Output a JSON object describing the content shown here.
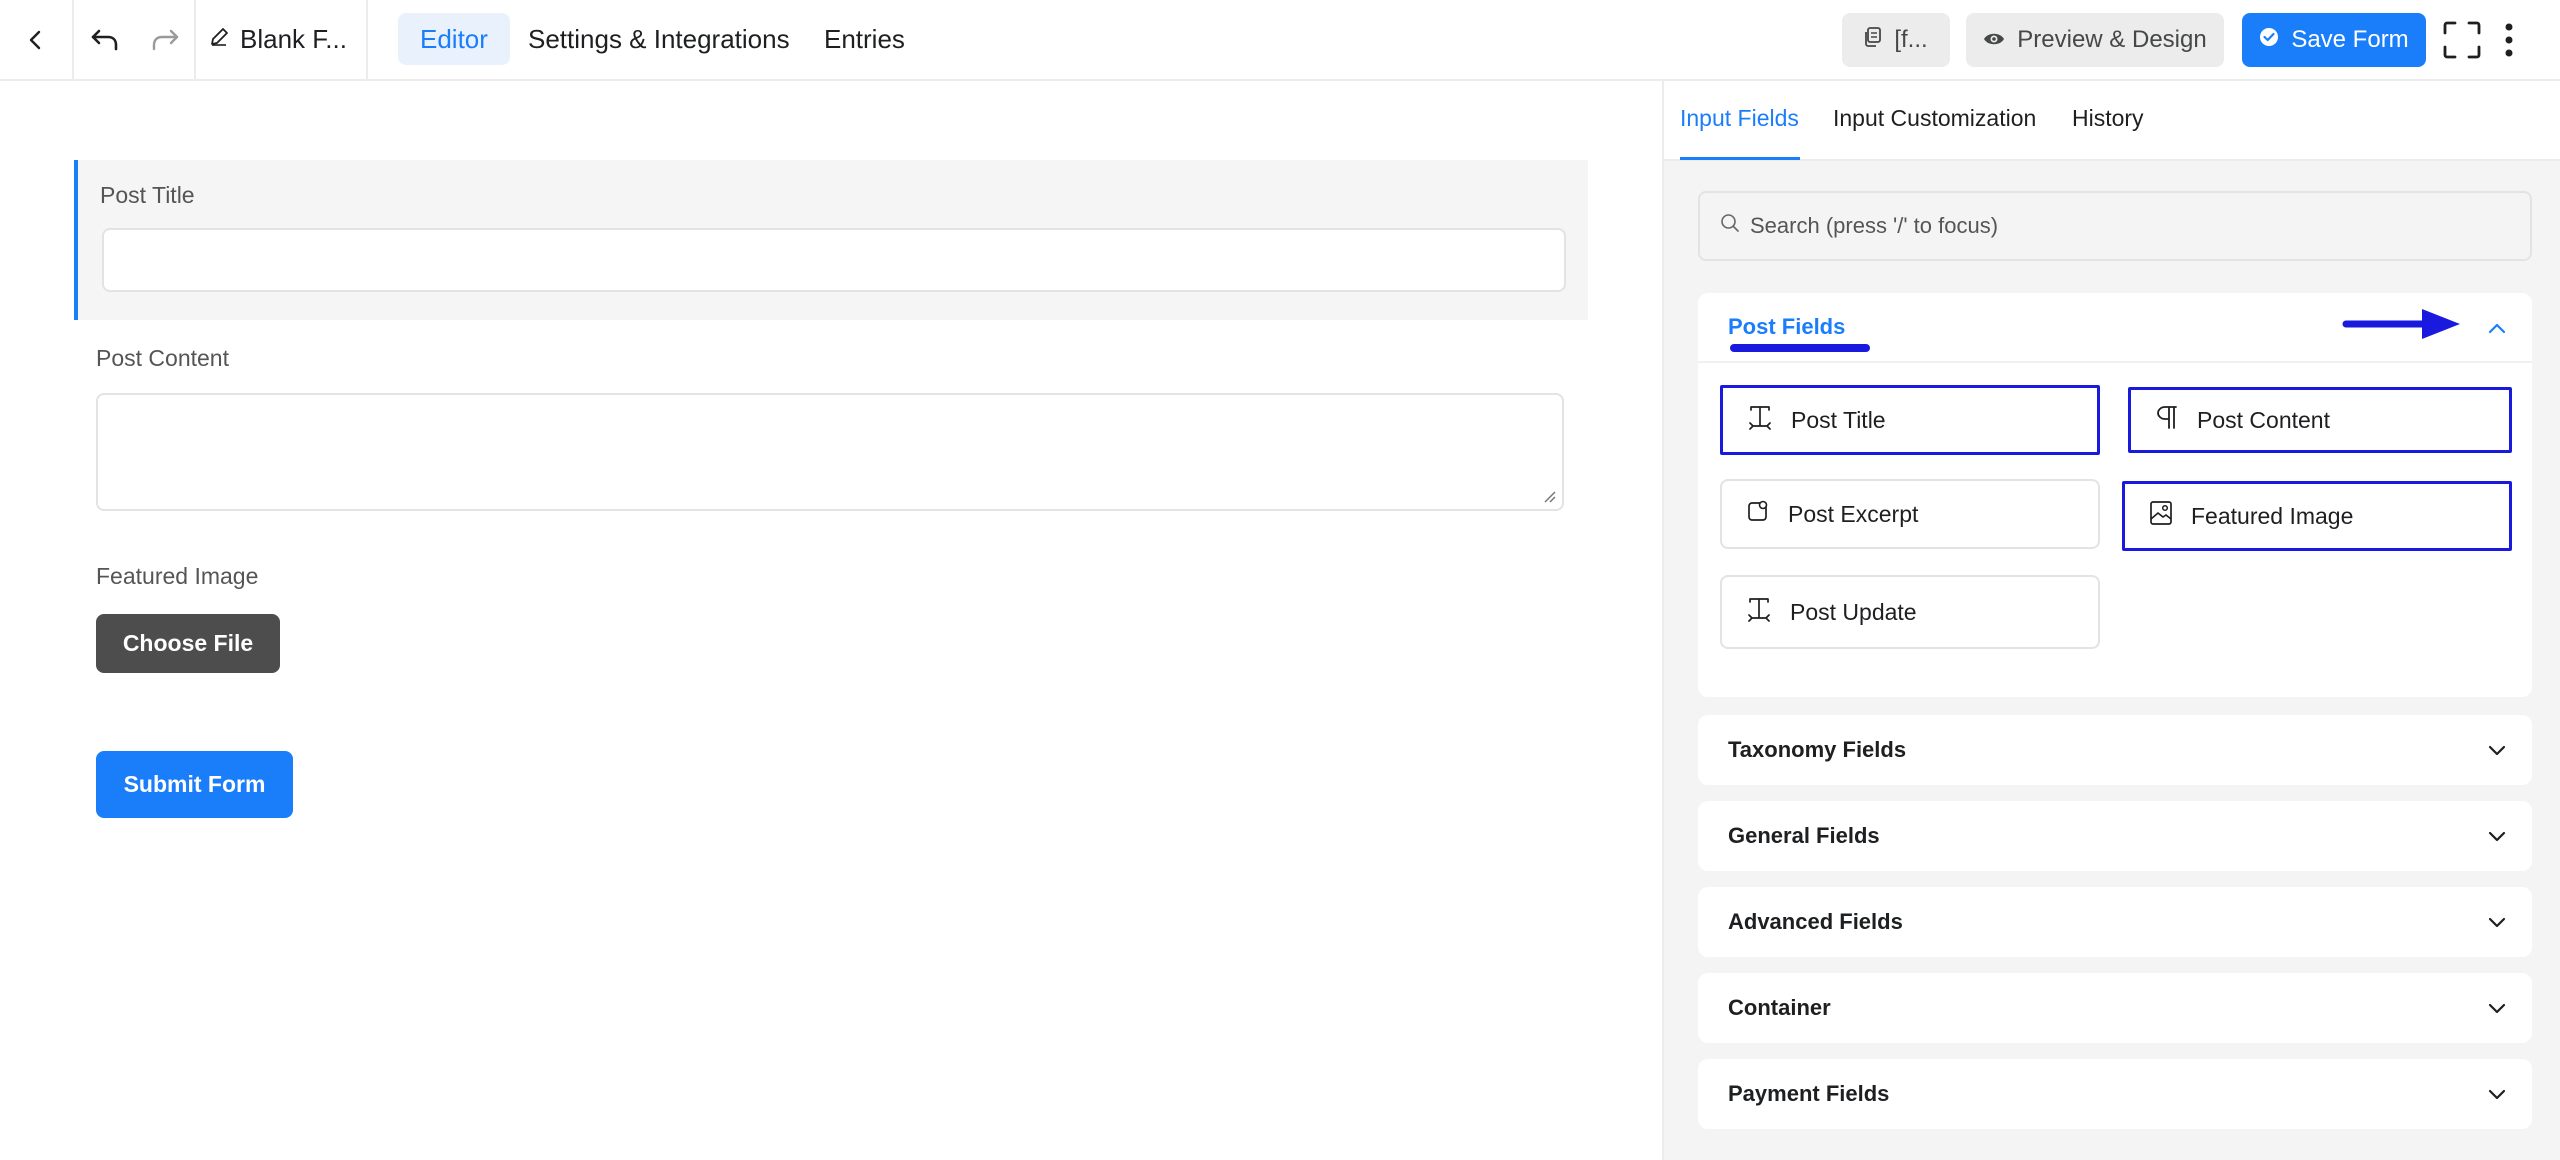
{
  "topbar": {
    "form_name": "Blank F...",
    "tabs": [
      "Editor",
      "Settings & Integrations",
      "Entries"
    ],
    "shortcode_label": "[f...",
    "preview_label": "Preview & Design",
    "save_label": "Save Form"
  },
  "editor": {
    "post_title_label": "Post Title",
    "post_content_label": "Post Content",
    "featured_image_label": "Featured Image",
    "choose_file_label": "Choose File",
    "submit_label": "Submit Form"
  },
  "sidebar": {
    "tabs": [
      "Input Fields",
      "Input Customization",
      "History"
    ],
    "search_placeholder": "Search (press '/' to focus)",
    "post_fields": {
      "title": "Post Fields",
      "items": [
        "Post Title",
        "Post Content",
        "Post Excerpt",
        "Featured Image",
        "Post Update"
      ]
    },
    "sections": [
      "Taxonomy Fields",
      "General Fields",
      "Advanced Fields",
      "Container",
      "Payment Fields"
    ]
  },
  "colors": {
    "accent": "#1a7efb",
    "annotation": "#1a1adf",
    "dark_button": "#4d4d4d"
  }
}
